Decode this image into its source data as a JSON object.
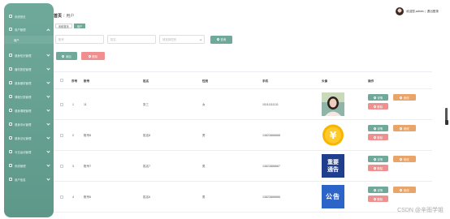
{
  "sidebar": {
    "items": [
      {
        "label": "系统首页"
      },
      {
        "label": "用户管理",
        "open": true,
        "sub": "用户"
      },
      {
        "label": "健身知识管理"
      },
      {
        "label": "器材类型管理"
      },
      {
        "label": "健身器材管理"
      },
      {
        "label": "课程分类管理"
      },
      {
        "label": "健身课程管理"
      },
      {
        "label": "健身评价管理"
      },
      {
        "label": "健身论坛管理"
      },
      {
        "label": "今日运动管理"
      },
      {
        "label": "系统管理"
      },
      {
        "label": "用户信息"
      }
    ]
  },
  "header": {
    "breadcrumb_home": "首页",
    "breadcrumb_sep": "/",
    "breadcrumb_current": "用户",
    "user_name": "欢迎您,admin",
    "user_sep": "|",
    "logout": "退出登录"
  },
  "tags": [
    {
      "label": "系统首页",
      "active": false
    },
    {
      "label": "用户",
      "active": true
    }
  ],
  "filters": {
    "account_placeholder": "账号",
    "name_placeholder": "姓名",
    "gender_placeholder": "请选择性别",
    "search_label": "查询"
  },
  "actions": {
    "add_label": "添加",
    "delete_label": "删除"
  },
  "table": {
    "headers": [
      "序号",
      "账号",
      "姓名",
      "性别",
      "手机",
      "头像",
      "操作"
    ],
    "row_buttons": {
      "detail": "详情",
      "edit": "修改",
      "delete": "删除"
    },
    "rows": [
      {
        "index": "1",
        "account": "11",
        "name": "张三",
        "gender": "女",
        "phone": "15111111111",
        "avatar": "photo"
      },
      {
        "index": "2",
        "account": "账号8",
        "name": "姓名8",
        "gender": "男",
        "phone": "13823888888",
        "avatar": "coin"
      },
      {
        "index": "3",
        "account": "账号7",
        "name": "姓名7",
        "gender": "男",
        "phone": "13823888887",
        "avatar": "notice",
        "avatar_text": "重要通告"
      },
      {
        "index": "4",
        "account": "账号6",
        "name": "姓名6",
        "gender": "男",
        "phone": "13823888886",
        "avatar": "announcement",
        "avatar_text": "公告"
      }
    ]
  },
  "watermark": "CSDN @辛雨学姐",
  "colors": {
    "primary": "#6fa99a",
    "edit": "#e9a46a",
    "delete": "#ef8f8f"
  }
}
